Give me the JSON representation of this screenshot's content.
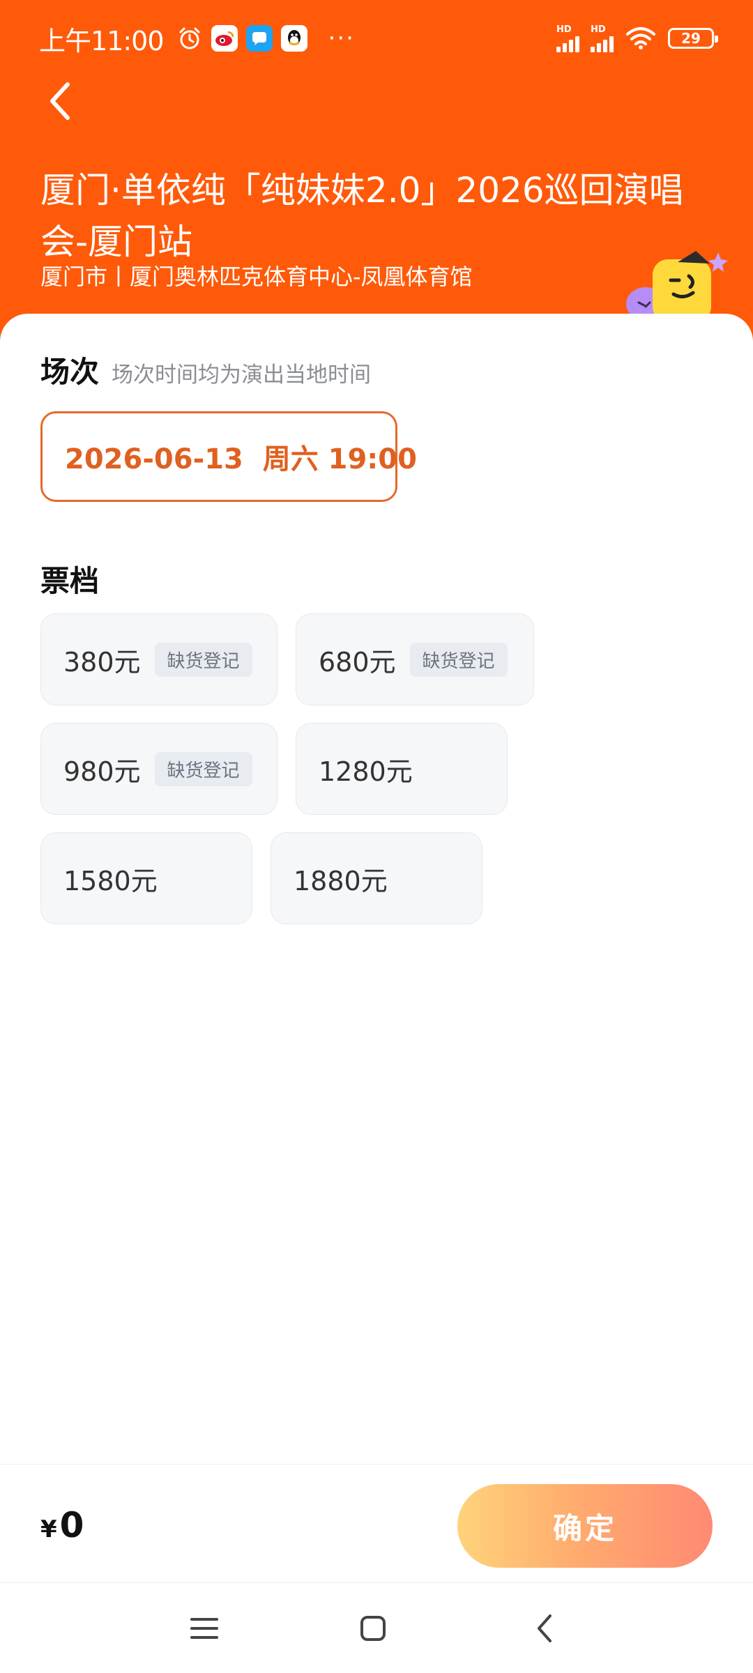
{
  "status_bar": {
    "time": "上午11:00",
    "battery": "29",
    "network_1": "HD",
    "network_2": "HD",
    "more": "···",
    "icons": [
      "alarm-icon",
      "weibo-icon",
      "message-icon",
      "qq-icon"
    ]
  },
  "header": {
    "title": "厦门·单依纯「纯妹妹2.0」2026巡回演唱会-厦门站",
    "venue": "厦门市丨厦门奥林匹克体育中心-凤凰体育馆"
  },
  "session": {
    "title": "场次",
    "subtitle": "场次时间均为演出当地时间",
    "selected": "2026-06-13  周六 19:00"
  },
  "tiers": {
    "title": "票档",
    "items": [
      {
        "price": "380元",
        "tag": "缺货登记"
      },
      {
        "price": "680元",
        "tag": "缺货登记"
      },
      {
        "price": "980元",
        "tag": "缺货登记"
      },
      {
        "price": "1280元"
      },
      {
        "price": "1580元"
      },
      {
        "price": "1880元"
      }
    ]
  },
  "footer": {
    "currency": "¥",
    "total": "0",
    "confirm_label": "确定"
  },
  "colors": {
    "header_bg": "#ff5a0a",
    "accent": "#e0601f"
  }
}
